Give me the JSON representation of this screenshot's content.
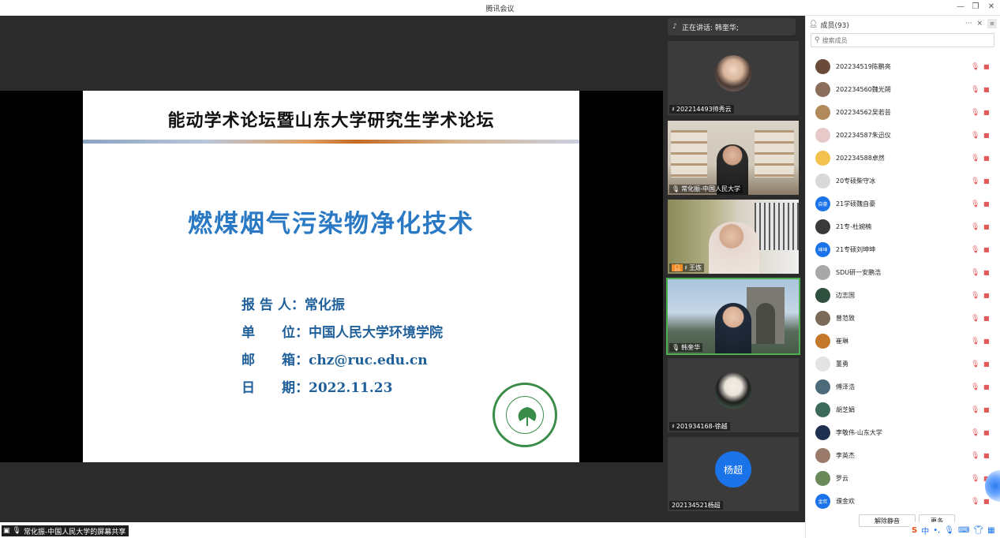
{
  "window": {
    "title": "腾讯会议"
  },
  "slide": {
    "header": "能动学术论坛暨山东大学研究生学术论坛",
    "subject": "燃煤烟气污染物净化技术",
    "reporter": "报 告 人：常化振",
    "unit": "单　　位：中国人民大学环境学院",
    "email": "邮　　箱：chz@ruc.edu.cn",
    "date": "日　　期：2022.11.23"
  },
  "share": {
    "label": "常化振-中国人民大学的屏幕共享"
  },
  "speaking": {
    "label": "正在讲话: 韩奎华;"
  },
  "video_tiles": [
    {
      "name": "202214493帅秀云"
    },
    {
      "name": "常化振-中国人民大学"
    },
    {
      "name": "王炼"
    },
    {
      "name": "韩奎华"
    },
    {
      "name": "201934168-徐越"
    },
    {
      "name": "202134521杨超",
      "avatar_text": "杨超"
    }
  ],
  "members_panel": {
    "title": "成员(93)",
    "more": "···",
    "close": "×",
    "search_placeholder": "搜索成员",
    "members": [
      {
        "name": "202234519陈鹏亮",
        "color": "#6b4a3a"
      },
      {
        "name": "202234560魏光朔",
        "color": "#8a6d5a"
      },
      {
        "name": "202234562吴若芸",
        "color": "#b08a5a"
      },
      {
        "name": "202234587朱迅仪",
        "color": "#e8c9c9"
      },
      {
        "name": "202234588卓然",
        "color": "#f2c14e"
      },
      {
        "name": "20专硕柴守冰",
        "color": "#d9d9d9"
      },
      {
        "name": "21学硕魏自豪",
        "color": "#1a73e8",
        "text": "自豪"
      },
      {
        "name": "21专-杜婉楠",
        "color": "#3a3a3a"
      },
      {
        "name": "21专硕刘坤坤",
        "color": "#1a73e8",
        "text": "坤坤"
      },
      {
        "name": "SDU研一安鹏浩",
        "color": "#a8a8a8"
      },
      {
        "name": "边志国",
        "color": "#2f4f3f"
      },
      {
        "name": "曾范致",
        "color": "#7a6a5a"
      },
      {
        "name": "崔琳",
        "color": "#c4782a"
      },
      {
        "name": "董勇",
        "color": "#e3e3e3"
      },
      {
        "name": "傅泽浩",
        "color": "#4d6a7a"
      },
      {
        "name": "胡芝娟",
        "color": "#3c6a5a"
      },
      {
        "name": "李敬伟-山东大学",
        "color": "#1f2f4f"
      },
      {
        "name": "李英杰",
        "color": "#9a7a6a"
      },
      {
        "name": "罗云",
        "color": "#6a8a5a"
      },
      {
        "name": "濮金欢",
        "color": "#1a73e8",
        "text": "金欢"
      }
    ],
    "unmute_all": "解除静音",
    "more_btn": "更多"
  },
  "tray": {
    "ime": "中",
    "punct": "•,"
  }
}
